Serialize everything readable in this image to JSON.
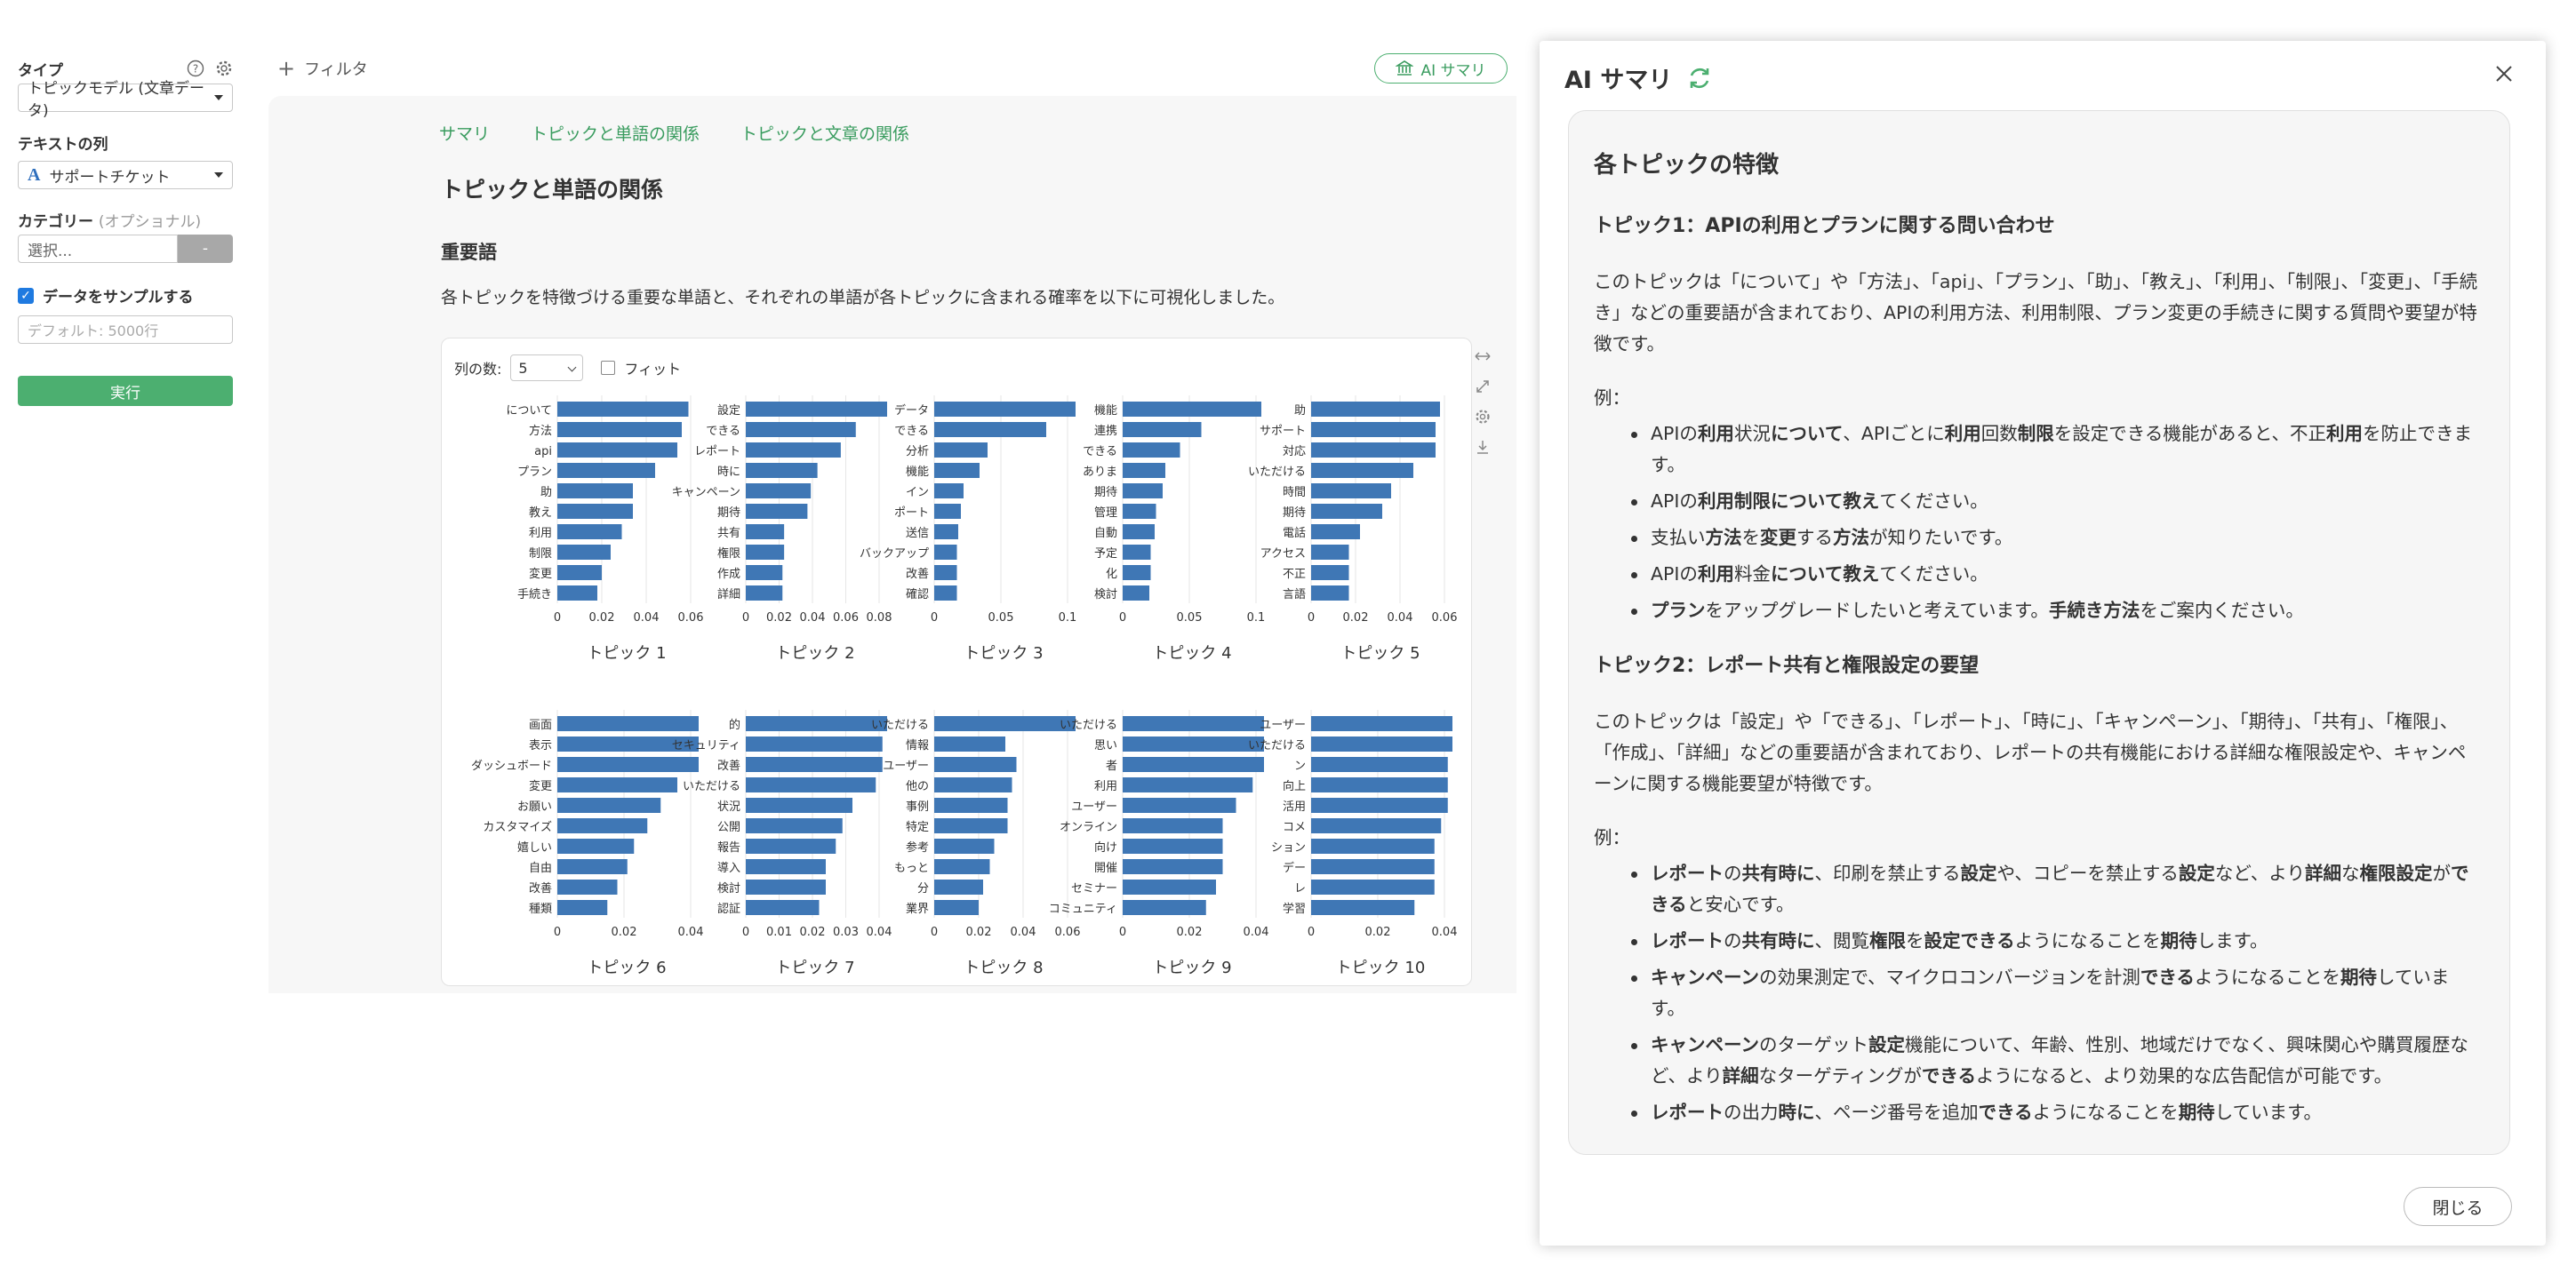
{
  "sidebar": {
    "type_label": "タイプ",
    "type_value": "トピックモデル (文章データ)",
    "text_col_label": "テキストの列",
    "text_col_value": "サポートチケット",
    "category_label": "カテゴリー",
    "category_optional": "(オプショナル)",
    "category_placeholder": "選択...",
    "category_btn": "-",
    "sample_label": "データをサンプルする",
    "sample_placeholder": "デフォルト: 5000行",
    "run_button": "実行"
  },
  "toolbar": {
    "filter_label": "フィルタ",
    "ai_summary_button": "AI サマリ"
  },
  "main": {
    "tabs": [
      "サマリ",
      "トピックと単語の関係",
      "トピックと文章の関係"
    ],
    "section_title": "トピックと単語の関係",
    "sub_title": "重要語",
    "description": "各トピックを特徴づける重要な単語と、それぞれの単語が各トピックに含まれる確率を以下に可視化しました。",
    "columns_label": "列の数:",
    "columns_value": "5",
    "fit_label": "フィット"
  },
  "chart_data": [
    {
      "type": "bar",
      "orientation": "horizontal",
      "title": "トピック 1",
      "categories": [
        "について",
        "方法",
        "api",
        "プラン",
        "助",
        "教え",
        "利用",
        "制限",
        "変更",
        "手続き"
      ],
      "values": [
        0.059,
        0.056,
        0.054,
        0.044,
        0.034,
        0.034,
        0.029,
        0.024,
        0.02,
        0.018
      ],
      "xticks": [
        "0",
        "0.02",
        "0.04",
        "0.06"
      ],
      "xlim": [
        0,
        0.06
      ],
      "bar_color": "#3f77b5"
    },
    {
      "type": "bar",
      "orientation": "horizontal",
      "title": "トピック 2",
      "categories": [
        "設定",
        "できる",
        "レポート",
        "時に",
        "キャンペーン",
        "期待",
        "共有",
        "権限",
        "作成",
        "詳細"
      ],
      "values": [
        0.087,
        0.066,
        0.057,
        0.043,
        0.039,
        0.037,
        0.023,
        0.023,
        0.022,
        0.022
      ],
      "xticks": [
        "0",
        "0.02",
        "0.04",
        "0.06",
        "0.08"
      ],
      "xlim": [
        0,
        0.08
      ],
      "bar_color": "#3f77b5"
    },
    {
      "type": "bar",
      "orientation": "horizontal",
      "title": "トピック 3",
      "categories": [
        "データ",
        "できる",
        "分析",
        "機能",
        "イン",
        "ポート",
        "送信",
        "バックアップ",
        "改善",
        "確認"
      ],
      "values": [
        0.128,
        0.084,
        0.04,
        0.034,
        0.022,
        0.02,
        0.018,
        0.017,
        0.017,
        0.017
      ],
      "xticks": [
        "0",
        "0.05",
        "0.1"
      ],
      "xlim": [
        0,
        0.1
      ],
      "bar_color": "#3f77b5"
    },
    {
      "type": "bar",
      "orientation": "horizontal",
      "title": "トピック 4",
      "categories": [
        "機能",
        "連携",
        "できる",
        "ありま",
        "期待",
        "管理",
        "自動",
        "予定",
        "化",
        "検討"
      ],
      "values": [
        0.104,
        0.059,
        0.043,
        0.032,
        0.03,
        0.025,
        0.024,
        0.021,
        0.021,
        0.02
      ],
      "xticks": [
        "0",
        "0.05",
        "0.1"
      ],
      "xlim": [
        0,
        0.1
      ],
      "bar_color": "#3f77b5"
    },
    {
      "type": "bar",
      "orientation": "horizontal",
      "title": "トピック 5",
      "categories": [
        "助",
        "サポート",
        "対応",
        "いただける",
        "時間",
        "期待",
        "電話",
        "アクセス",
        "不正",
        "言語"
      ],
      "values": [
        0.058,
        0.056,
        0.056,
        0.046,
        0.036,
        0.032,
        0.022,
        0.017,
        0.017,
        0.017
      ],
      "xticks": [
        "0",
        "0.02",
        "0.04",
        "0.06"
      ],
      "xlim": [
        0,
        0.06
      ],
      "bar_color": "#3f77b5"
    },
    {
      "type": "bar",
      "orientation": "horizontal",
      "title": "トピック 6",
      "categories": [
        "画面",
        "表示",
        "ダッシュボード",
        "変更",
        "お願い",
        "カスタマイズ",
        "嬉しい",
        "自由",
        "改善",
        "種類"
      ],
      "values": [
        0.058,
        0.052,
        0.052,
        0.036,
        0.031,
        0.027,
        0.023,
        0.021,
        0.018,
        0.015
      ],
      "xticks": [
        "0",
        "0.02",
        "0.04"
      ],
      "xlim": [
        0,
        0.04
      ],
      "bar_color": "#3f77b5"
    },
    {
      "type": "bar",
      "orientation": "horizontal",
      "title": "トピック 7",
      "categories": [
        "的",
        "セキュリティ",
        "改善",
        "いただける",
        "状況",
        "公開",
        "報告",
        "導入",
        "検討",
        "認証"
      ],
      "values": [
        0.049,
        0.041,
        0.041,
        0.039,
        0.032,
        0.029,
        0.027,
        0.024,
        0.024,
        0.022
      ],
      "xticks": [
        "0",
        "0.01",
        "0.02",
        "0.03",
        "0.04"
      ],
      "xlim": [
        0,
        0.04
      ],
      "bar_color": "#3f77b5"
    },
    {
      "type": "bar",
      "orientation": "horizontal",
      "title": "トピック 8",
      "categories": [
        "いただける",
        "情報",
        "ユーザー",
        "他の",
        "事例",
        "特定",
        "参考",
        "もっと",
        "分",
        "業界"
      ],
      "values": [
        0.066,
        0.032,
        0.037,
        0.035,
        0.033,
        0.033,
        0.027,
        0.025,
        0.022,
        0.02
      ],
      "xticks": [
        "0",
        "0.02",
        "0.04",
        "0.06"
      ],
      "xlim": [
        0,
        0.06
      ],
      "bar_color": "#3f77b5"
    },
    {
      "type": "bar",
      "orientation": "horizontal",
      "title": "トピック 9",
      "categories": [
        "いただける",
        "思い",
        "者",
        "利用",
        "ユーザー",
        "オンライン",
        "向け",
        "開催",
        "セミナー",
        "コミュニティ"
      ],
      "values": [
        0.062,
        0.045,
        0.045,
        0.039,
        0.034,
        0.03,
        0.03,
        0.03,
        0.028,
        0.025
      ],
      "xticks": [
        "0",
        "0.02",
        "0.04"
      ],
      "xlim": [
        0,
        0.04
      ],
      "bar_color": "#3f77b5"
    },
    {
      "type": "bar",
      "orientation": "horizontal",
      "title": "トピック 10",
      "categories": [
        "ユーザー",
        "いただける",
        "ン",
        "向上",
        "活用",
        "コメ",
        "ション",
        "デー",
        "レ",
        "学習"
      ],
      "values": [
        0.061,
        0.049,
        0.041,
        0.041,
        0.041,
        0.039,
        0.037,
        0.037,
        0.037,
        0.031
      ],
      "xticks": [
        "0",
        "0.02",
        "0.04"
      ],
      "xlim": [
        0,
        0.04
      ],
      "bar_color": "#3f77b5"
    }
  ],
  "ai_panel": {
    "title": "AI サマリ",
    "heading": "各トピックの特徴",
    "close_button": "閉じる",
    "topics": [
      {
        "title": "トピック1：APIの利用とプランに関する問い合わせ",
        "description": "このトピックは「について」や「方法」、「api」、「プラン」、「助」、「教え」、「利用」、「制限」、「変更」、「手続き」などの重要語が含まれており、APIの利用方法、利用制限、プラン変更の手続きに関する質問や要望が特徴です。",
        "example_label": "例：",
        "examples": [
          "APIの<b>利用</b>状況<b>について</b>、APIごとに<b>利用</b>回数<b>制限</b>を設定できる機能があると、不正<b>利用</b>を防止できます。",
          "APIの<b>利用制限について教え</b>てください。",
          "支払い<b>方法</b>を<b>変更</b>する<b>方法</b>が知りたいです。",
          "APIの<b>利用</b>料金<b>について教え</b>てください。",
          "<b>プラン</b>をアップグレードしたいと考えています。<b>手続き方法</b>をご案内ください。"
        ]
      },
      {
        "title": "トピック2：レポート共有と権限設定の要望",
        "description": "このトピックは「設定」や「できる」、「レポート」、「時に」、「キャンペーン」、「期待」、「共有」、「権限」、「作成」、「詳細」などの重要語が含まれており、レポートの共有機能における詳細な権限設定や、キャンペーンに関する機能要望が特徴です。",
        "example_label": "例：",
        "examples": [
          "<b>レポート</b>の<b>共有時に</b>、印刷を禁止する<b>設定</b>や、コピーを禁止する<b>設定</b>など、より<b>詳細</b>な<b>権限設定</b>が<b>できる</b>と安心です。",
          "<b>レポート</b>の<b>共有時に</b>、閲覧<b>権限</b>を<b>設定できる</b>ようになることを<b>期待</b>します。",
          "<b>キャンペーン</b>の効果測定で、マイクロコンバージョンを計測<b>できる</b>ようになることを<b>期待</b>しています。",
          "<b>キャンペーン</b>のターゲット<b>設定</b>機能について、年齢、性別、地域だけでなく、興味関心や購買履歴など、より<b>詳細</b>なターゲティングが<b>できる</b>ようになると、より効果的な広告配信が可能です。",
          "<b>レポート</b>の出力<b>時に</b>、ページ番号を追加<b>できる</b>ようになることを<b>期待</b>しています。"
        ]
      }
    ]
  }
}
